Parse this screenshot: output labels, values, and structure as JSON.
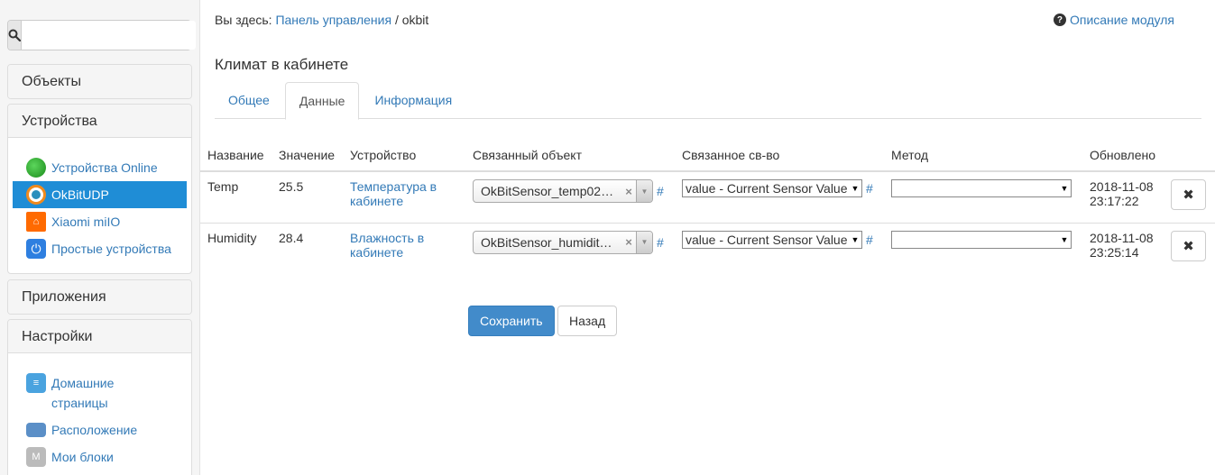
{
  "sidebar": {
    "search": {
      "placeholder": "",
      "value": ""
    },
    "sections": {
      "objects": "Объекты",
      "devices": "Устройства",
      "apps": "Приложения",
      "settings": "Настройки"
    },
    "device_items": [
      {
        "label": "Устройства Online",
        "icon": "green-dot-icon"
      },
      {
        "label": "OkBitUDP",
        "icon": "okbit-icon"
      },
      {
        "label": "Xiaomi miIO",
        "icon": "xiaomi-icon"
      },
      {
        "label": "Простые устройства",
        "icon": "power-icon"
      }
    ],
    "settings_items": [
      {
        "label": "Домашние страницы",
        "icon": "document-icon"
      },
      {
        "label": "Расположение",
        "icon": "folder-icon"
      },
      {
        "label": "Мои блоки",
        "icon": "block-icon"
      }
    ]
  },
  "breadcrumb": {
    "prefix": "Вы здесь:",
    "link": "Панель управления",
    "separator": "/",
    "current": "okbit"
  },
  "module_help": "Описание модуля",
  "page_title": "Климат в кабинете",
  "tabs": [
    "Общее",
    "Данные",
    "Информация"
  ],
  "active_tab": 1,
  "table": {
    "headers": [
      "Название",
      "Значение",
      "Устройство",
      "Связанный объект",
      "Связанное св-во",
      "Метод",
      "Обновлено"
    ],
    "rows": [
      {
        "name": "Temp",
        "value": "25.5",
        "device": "Температура в кабинете",
        "linked_object": "OkBitSensor_temp02…",
        "linked_property": "value - Current Sensor Value",
        "method": "",
        "updated_date": "2018-11-08",
        "updated_time": "23:17:22"
      },
      {
        "name": "Humidity",
        "value": "28.4",
        "device": "Влажность в кабинете",
        "linked_object": "OkBitSensor_humidit…",
        "linked_property": "value - Current Sensor Value",
        "method": "",
        "updated_date": "2018-11-08",
        "updated_time": "23:25:14"
      }
    ]
  },
  "buttons": {
    "save": "Сохранить",
    "back": "Назад"
  },
  "colors": {
    "accent": "#428bca",
    "active_item": "#1f8dd6",
    "link": "#337ab7"
  }
}
